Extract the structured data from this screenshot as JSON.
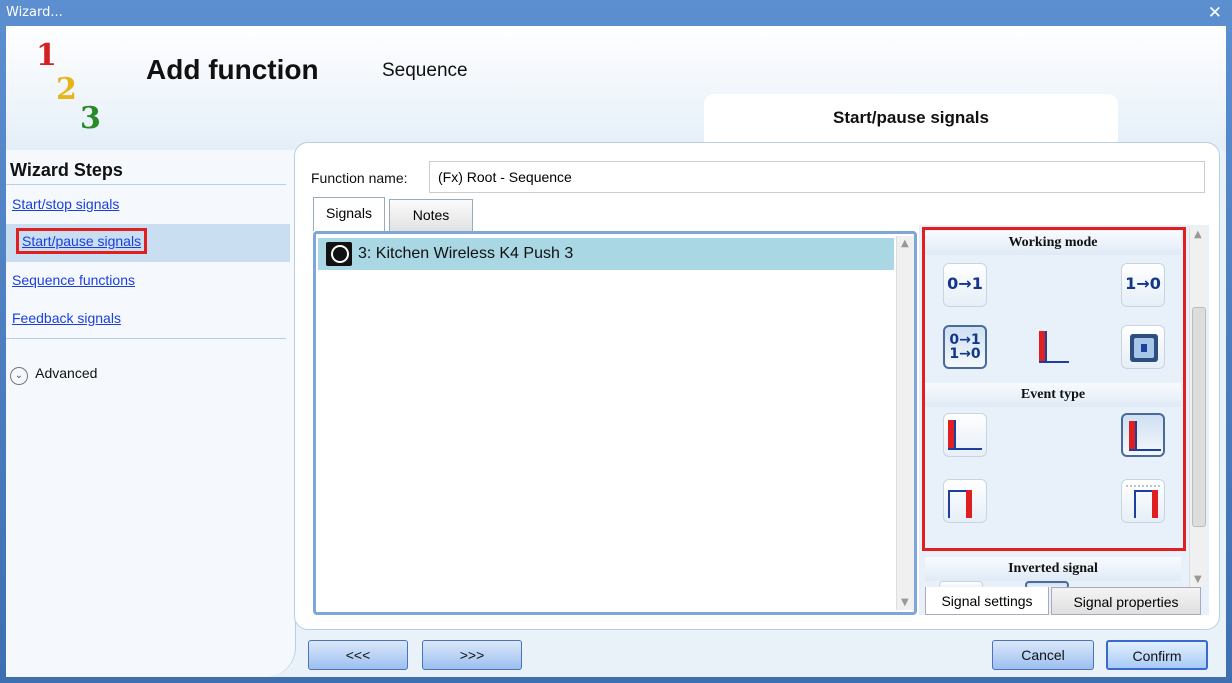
{
  "window": {
    "title": "Wizard...",
    "close_glyph": "✕"
  },
  "header": {
    "logo_digits": [
      "1",
      "2",
      "3"
    ],
    "title": "Add function",
    "subtitle": "Sequence",
    "step_tab": "Start/pause signals"
  },
  "sidebar": {
    "title": "Wizard Steps",
    "items": [
      {
        "label": "Start/stop signals"
      },
      {
        "label": "Start/pause signals",
        "active": true
      },
      {
        "label": "Sequence functions"
      },
      {
        "label": "Feedback signals"
      }
    ],
    "advanced_label": "Advanced",
    "advanced_glyph": "⌄"
  },
  "main": {
    "function_name_label": "Function name:",
    "function_name_value": "(Fx) Root - Sequence",
    "tabs": [
      {
        "label": "Signals",
        "selected": true
      },
      {
        "label": "Notes"
      }
    ],
    "signals": [
      {
        "label": "3: Kitchen Wireless K4 Push 3",
        "selected": true
      }
    ]
  },
  "settings": {
    "working_mode_title": "Working mode",
    "working_mode_buttons": [
      {
        "icon": "rising-edge-0-1-icon",
        "text": "0→1"
      },
      {
        "icon": "falling-edge-1-0-icon",
        "text": "1→0"
      },
      {
        "icon": "both-edges-icon",
        "text_top": "0→1",
        "text_bottom": "1→0"
      },
      {
        "icon": "pulse-level-icon"
      },
      {
        "icon": "push-button-icon"
      }
    ],
    "event_type_title": "Event type",
    "event_type_buttons": [
      {
        "icon": "event-rising-icon"
      },
      {
        "icon": "event-rising-framed-icon",
        "selected": true
      },
      {
        "icon": "event-pulse-icon"
      },
      {
        "icon": "event-pulse-dotted-icon"
      }
    ],
    "inverted_signal_title": "Inverted signal",
    "bottom_tabs": [
      {
        "label": "Signal settings",
        "selected": true
      },
      {
        "label": "Signal properties"
      }
    ]
  },
  "footer": {
    "back_label": "<<<",
    "next_label": ">>>",
    "cancel_label": "Cancel",
    "confirm_label": "Confirm"
  },
  "colors": {
    "highlight": "#e02020",
    "link": "#1a3ee0",
    "signal_red": "#e02020",
    "signal_blue": "#1e3fa0",
    "row_selected": "#aad7e4"
  }
}
